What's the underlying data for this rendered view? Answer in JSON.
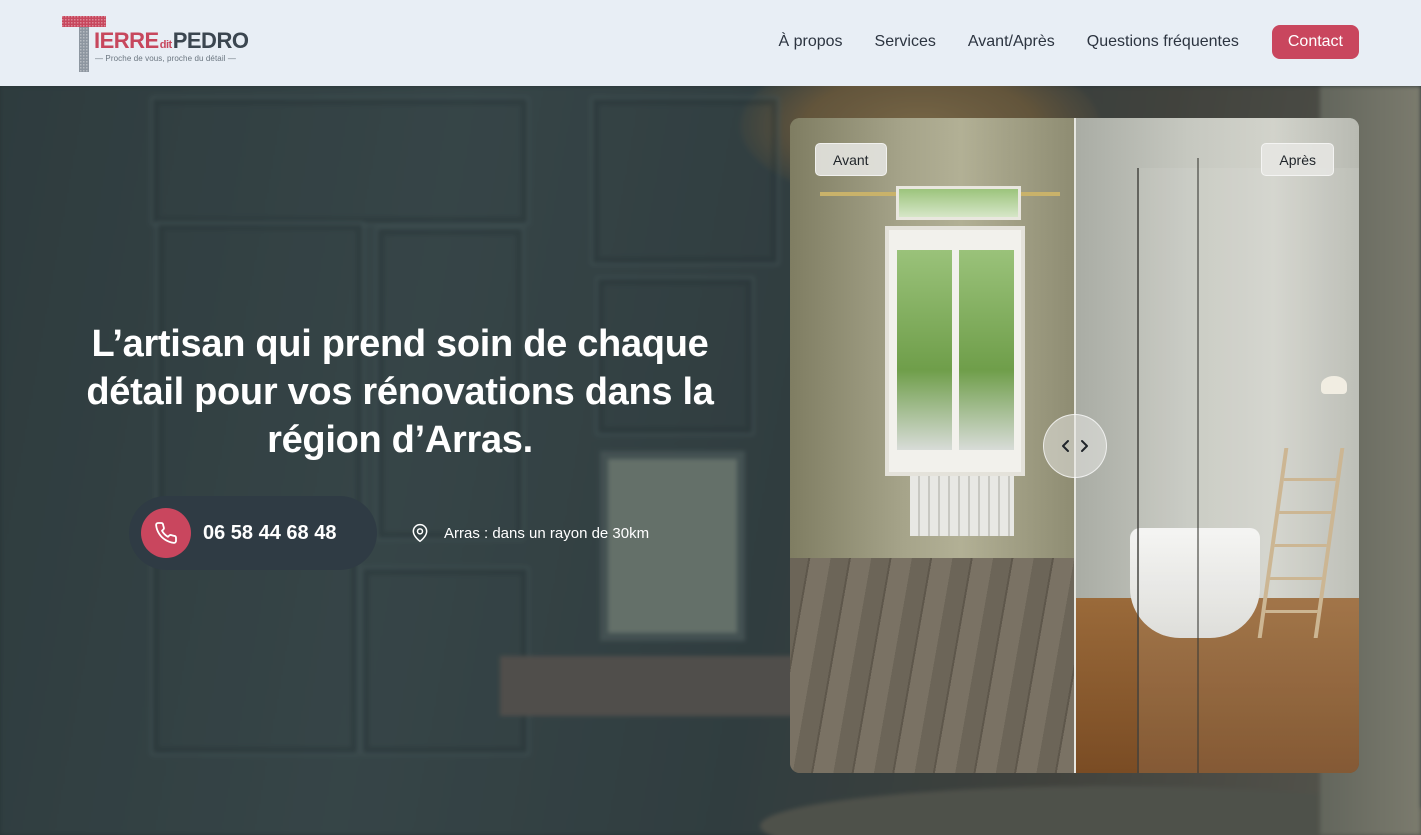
{
  "brand": {
    "logo_word_1": "IERRE",
    "logo_word_dit": "dit",
    "logo_word_2": "PEDRO",
    "tagline": "— Proche de vous, proche du détail —"
  },
  "nav": {
    "items": [
      "À propos",
      "Services",
      "Avant/Après",
      "Questions fréquentes"
    ],
    "contact_label": "Contact"
  },
  "hero": {
    "headline": "L’artisan qui prend soin de chaque détail pour vos rénovations dans la région d’Arras.",
    "phone": "06 58 44 68 48",
    "location": "Arras : dans un rayon de 30km"
  },
  "compare": {
    "before_label": "Avant",
    "after_label": "Après"
  },
  "colors": {
    "accent": "#c9465e",
    "header_bg": "#e8eef5",
    "nav_text": "#2c3440",
    "pill_bg": "#2f3b44"
  },
  "icons": {
    "phone": "phone-icon",
    "location": "map-pin-icon",
    "prev": "chevron-left-icon",
    "next": "chevron-right-icon"
  }
}
